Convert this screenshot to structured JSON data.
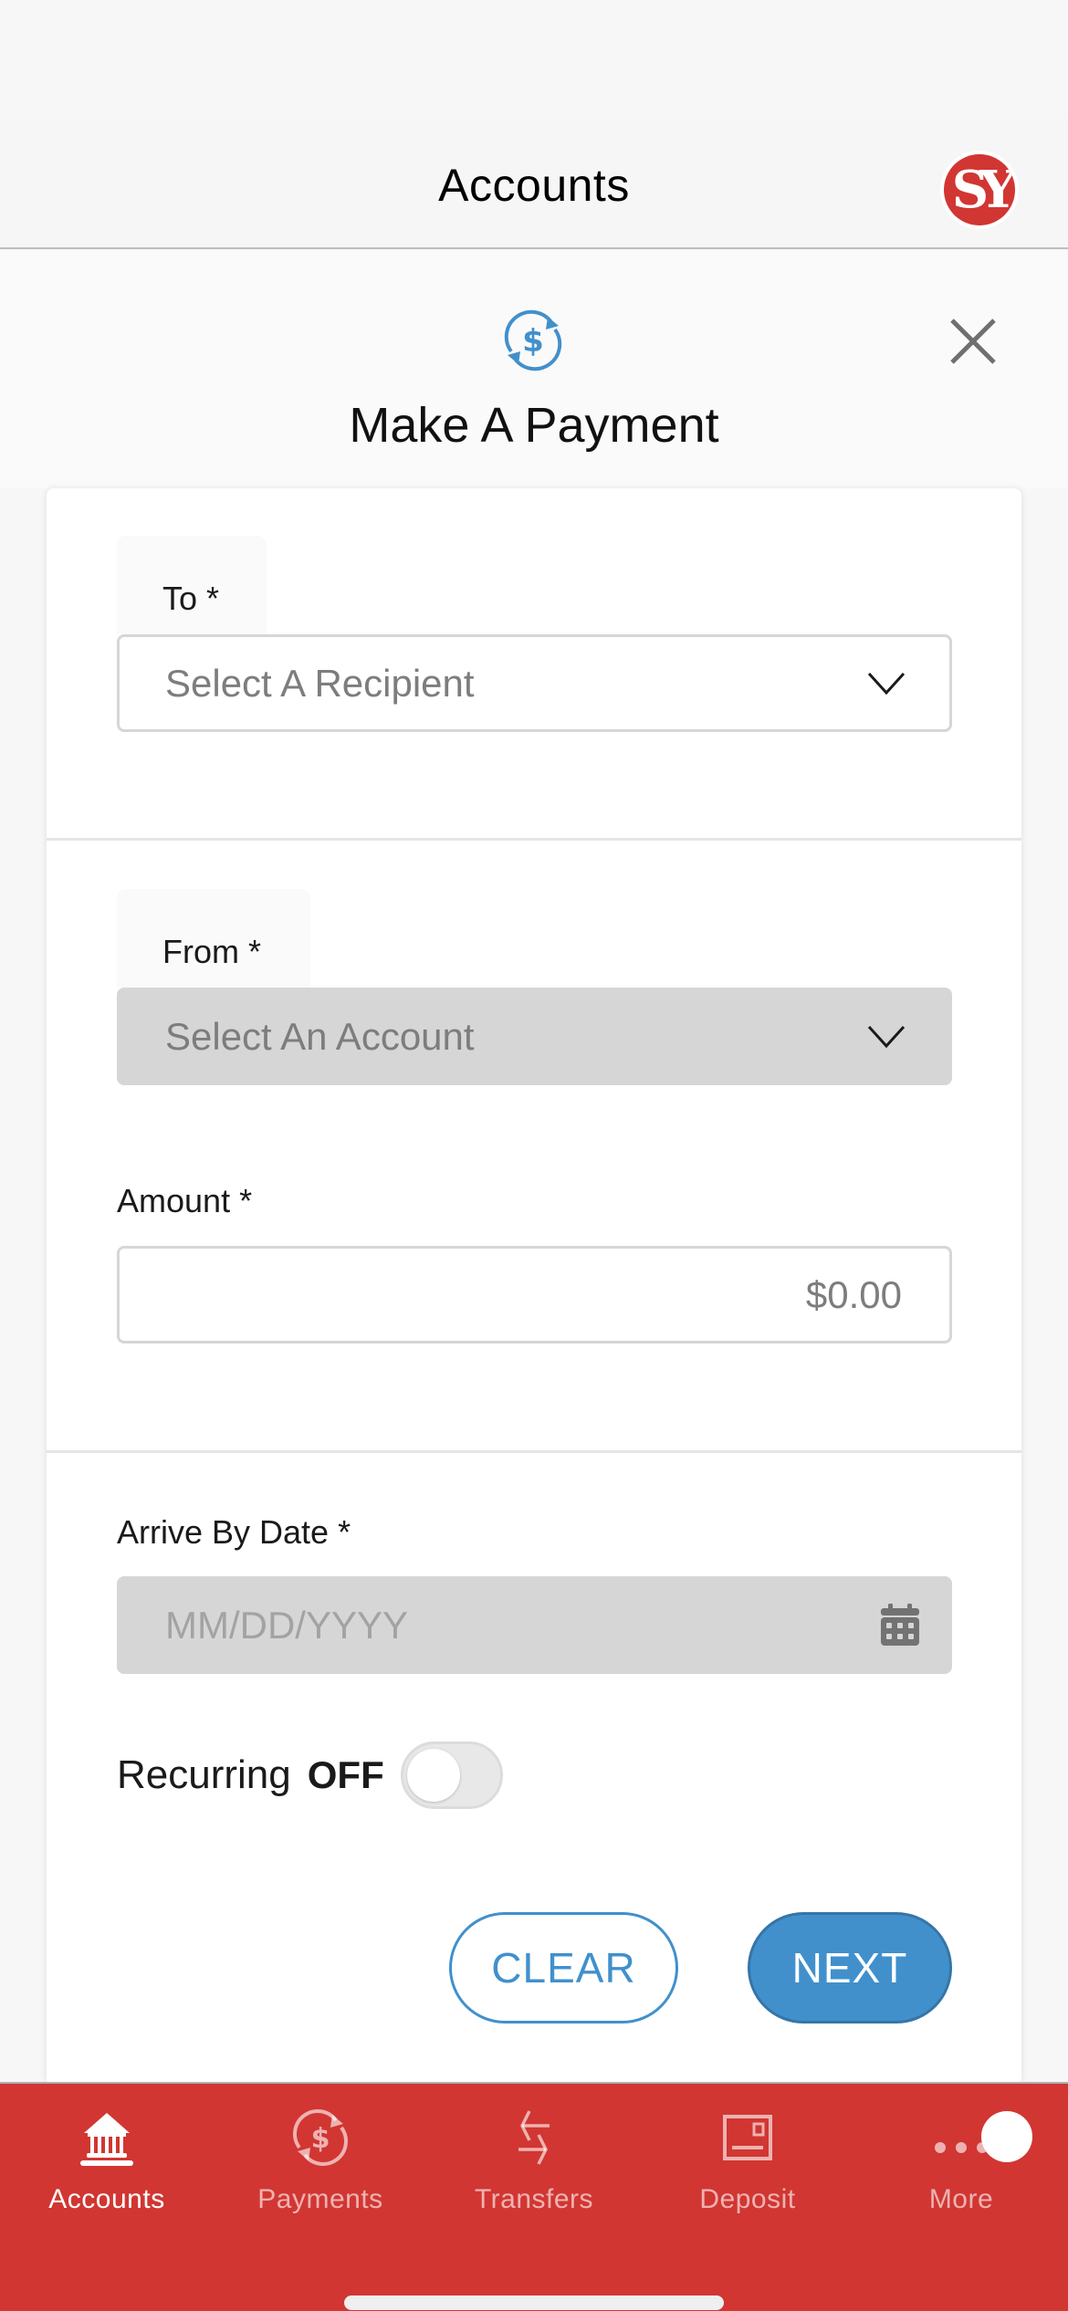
{
  "nav": {
    "title": "Accounts",
    "avatar_initials": "SY"
  },
  "modal": {
    "title": "Make A Payment",
    "icon": "payment-cycle-icon",
    "close_icon": "close-icon"
  },
  "form": {
    "to": {
      "label": "To *",
      "placeholder": "Select A Recipient"
    },
    "from": {
      "label": "From *",
      "placeholder": "Select An Account"
    },
    "amount": {
      "label": "Amount *",
      "placeholder": "$0.00",
      "value": ""
    },
    "arrive_by": {
      "label": "Arrive By Date *",
      "placeholder": "MM/DD/YYYY",
      "value": ""
    },
    "recurring": {
      "label": "Recurring",
      "state": "OFF",
      "enabled": false
    }
  },
  "buttons": {
    "clear": "CLEAR",
    "next": "NEXT"
  },
  "tab_bar": {
    "items": [
      {
        "label": "Accounts",
        "icon": "bank-icon",
        "active": true
      },
      {
        "label": "Payments",
        "icon": "payment-cycle-icon",
        "active": false
      },
      {
        "label": "Transfers",
        "icon": "transfer-arrows-icon",
        "active": false
      },
      {
        "label": "Deposit",
        "icon": "check-deposit-icon",
        "active": false
      },
      {
        "label": "More",
        "icon": "more-dots-icon",
        "active": false
      }
    ]
  },
  "colors": {
    "brand_red": "#d13632",
    "accent_blue": "#4190cc",
    "disabled_gray": "#d6d6d6",
    "placeholder_gray": "#7d7d7d"
  }
}
